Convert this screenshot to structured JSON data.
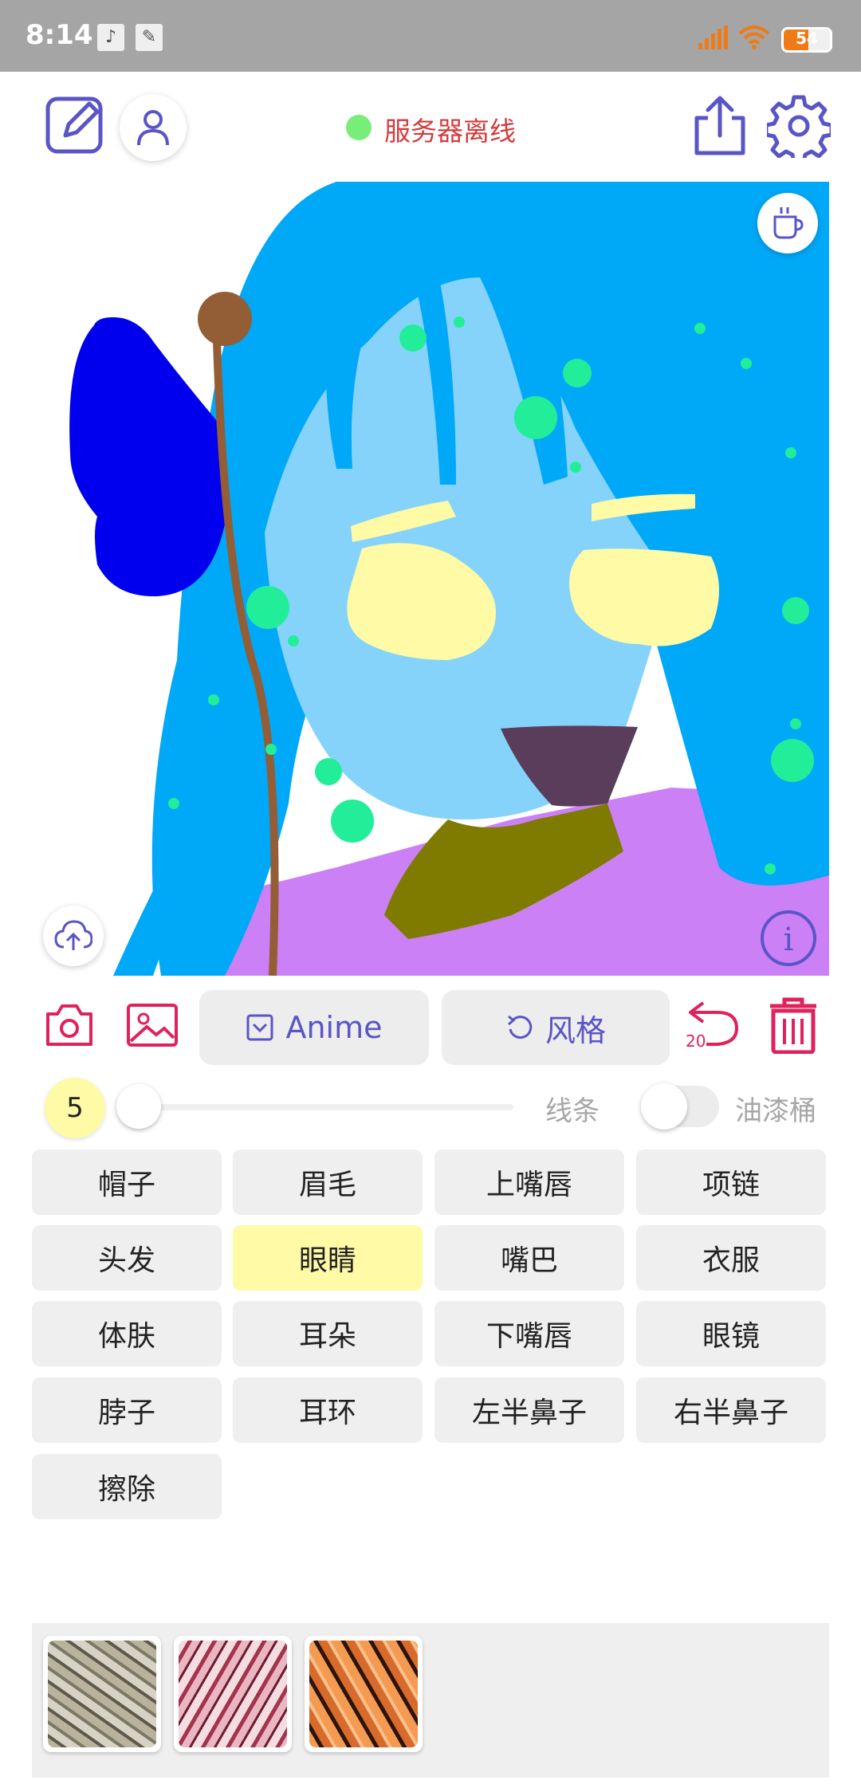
{
  "status_bar": {
    "time": "8:14",
    "battery": "54"
  },
  "header": {
    "server_status": "服务器离线"
  },
  "toolbar": {
    "anime_label": "Anime",
    "style_label": "风格",
    "undo_count": "20"
  },
  "brush": {
    "size": "5",
    "line_label": "线条",
    "bucket_label": "油漆桶"
  },
  "categories": [
    "帽子",
    "眉毛",
    "上嘴唇",
    "项链",
    "头发",
    "眼睛",
    "嘴巴",
    "衣服",
    "体肤",
    "耳朵",
    "下嘴唇",
    "眼镜",
    "脖子",
    "耳环",
    "左半鼻子",
    "右半鼻子",
    "擦除"
  ],
  "selected_category": "眼睛",
  "colors": {
    "accent": "#5a55c7",
    "red_icon": "#e0215b",
    "selected": "#fefaa6",
    "hair": "#00a8f8",
    "skin": "#85d3fb",
    "eyes": "#fefaa6",
    "mouth": "#5a3d5b",
    "neck": "#7f7a00",
    "clothes": "#cc80f5",
    "hat": "#0000ee",
    "earring": "#935d36",
    "dots": "#22ee99"
  }
}
